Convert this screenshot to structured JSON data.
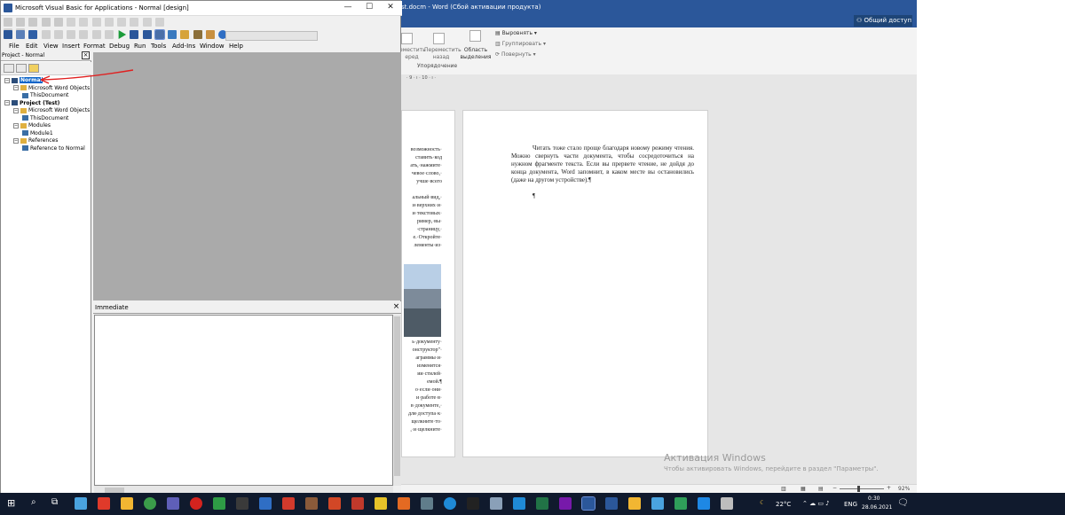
{
  "vba": {
    "title": "Microsoft Visual Basic for Applications - Normal [design]",
    "menu": [
      "File",
      "Edit",
      "View",
      "Insert",
      "Format",
      "Debug",
      "Run",
      "Tools",
      "Add-Ins",
      "Window",
      "Help"
    ],
    "project_pane_title": "Project - Normal",
    "tree": [
      {
        "label": "Normal",
        "level": 0,
        "toggle": "−",
        "selected": true
      },
      {
        "label": "Microsoft Word Objects",
        "level": 1,
        "toggle": "−"
      },
      {
        "label": "ThisDocument",
        "level": 2
      },
      {
        "label": "Project (Test)",
        "level": 0,
        "toggle": "−",
        "bold": true
      },
      {
        "label": "Microsoft Word Objects",
        "level": 1,
        "toggle": "−"
      },
      {
        "label": "ThisDocument",
        "level": 2
      },
      {
        "label": "Modules",
        "level": 1,
        "toggle": "−"
      },
      {
        "label": "Module1",
        "level": 2
      },
      {
        "label": "References",
        "level": 1,
        "toggle": "−"
      },
      {
        "label": "Reference to Normal",
        "level": 2
      }
    ],
    "immediate_title": "Immediate",
    "close_glyph": "×"
  },
  "word": {
    "title_fragment": "st.docm - Word (Сбой активации продукта)",
    "share_label": "Общий доступ",
    "ribbon": {
      "move_forward": "еместить\nеред",
      "move_back": "Переместить\nназад",
      "selection_pane": "Область\nвыделения",
      "align": "Выровнять",
      "group": "Группировать",
      "rotate": "Повернуть",
      "arrange_group": "Упорядочение"
    },
    "ruler_text": "· 9 · ı · 10 · ı ·",
    "page2_text": "Читать тоже стало проще благодаря новому режиму чтения. Можно свернуть части документа, чтобы сосредоточиться на нужном фрагменте текста. Если вы прервете чтение, не дойдя до конца документа, Word запомнит, в каком месте вы остановились (даже на другом устройстве).¶",
    "page2_pilcrow": "¶",
    "page1_fragments": [
      "возможность·",
      "ставить·код",
      "ать,·нажмите·",
      "чевое·слово,·",
      "учше·всего",
      "",
      "альный·вид,·",
      "и·верхних·и·",
      "и·текстовых·",
      "ример,·вы·",
      "·страницу,·",
      "е.·Откройте·",
      "лементы·из·"
    ],
    "page1_fragments_b": [
      "ь·документу·",
      "онструктор\"·",
      "аграммы·и·",
      "изменятся·",
      "ии·стилей·",
      "емой.¶",
      "о·если·они·",
      "и·работе·в·",
      "в·документе,·",
      "для·доступа·к·",
      "щелкните·то·",
      ",·и·щелкните·"
    ],
    "activation_title": "Активация Windows",
    "activation_sub": "Чтобы активировать Windows, перейдите в раздел \"Параметры\".",
    "zoom": "92%"
  },
  "taskbar": {
    "temperature": "22°C",
    "language": "ENG",
    "time": "0:30",
    "date": "28.06.2021"
  },
  "colors": {
    "word_blue": "#2b579a",
    "selection": "#0a64c8",
    "taskbar": "#101a2d",
    "arrow": "#e02020"
  }
}
